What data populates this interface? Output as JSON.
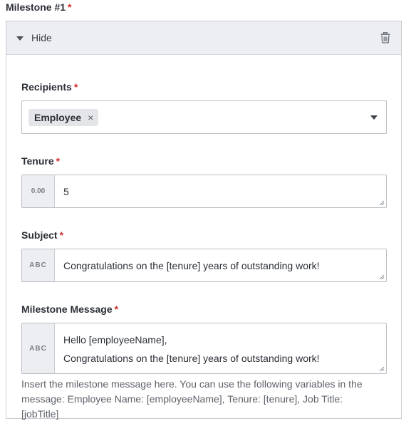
{
  "milestone": {
    "title": "Milestone #1",
    "required_mark": "*",
    "toggle_label": "Hide",
    "delete_icon": "trash-icon"
  },
  "fields": {
    "recipients": {
      "label": "Recipients",
      "chips": [
        "Employee"
      ],
      "chip_remove_glyph": "×"
    },
    "tenure": {
      "label": "Tenure",
      "addon": "0.00",
      "value": "5"
    },
    "subject": {
      "label": "Subject",
      "addon": "ABC",
      "value": "Congratulations on the [tenure] years of outstanding work!"
    },
    "message": {
      "label": "Milestone Message",
      "addon": "ABC",
      "line1": "Hello [employeeName],",
      "line2": "Congratulations on the [tenure] years of outstanding work!",
      "help": "Insert the milestone message here. You can use the following variables in the message: Employee Name: [employeeName], Tenure: [tenure], Job Title: [jobTitle]"
    }
  },
  "colors": {
    "required": "#d0312d",
    "header_bg": "#eceef1",
    "chip_bg": "#e3e5e8",
    "border": "#b9bdc3"
  }
}
